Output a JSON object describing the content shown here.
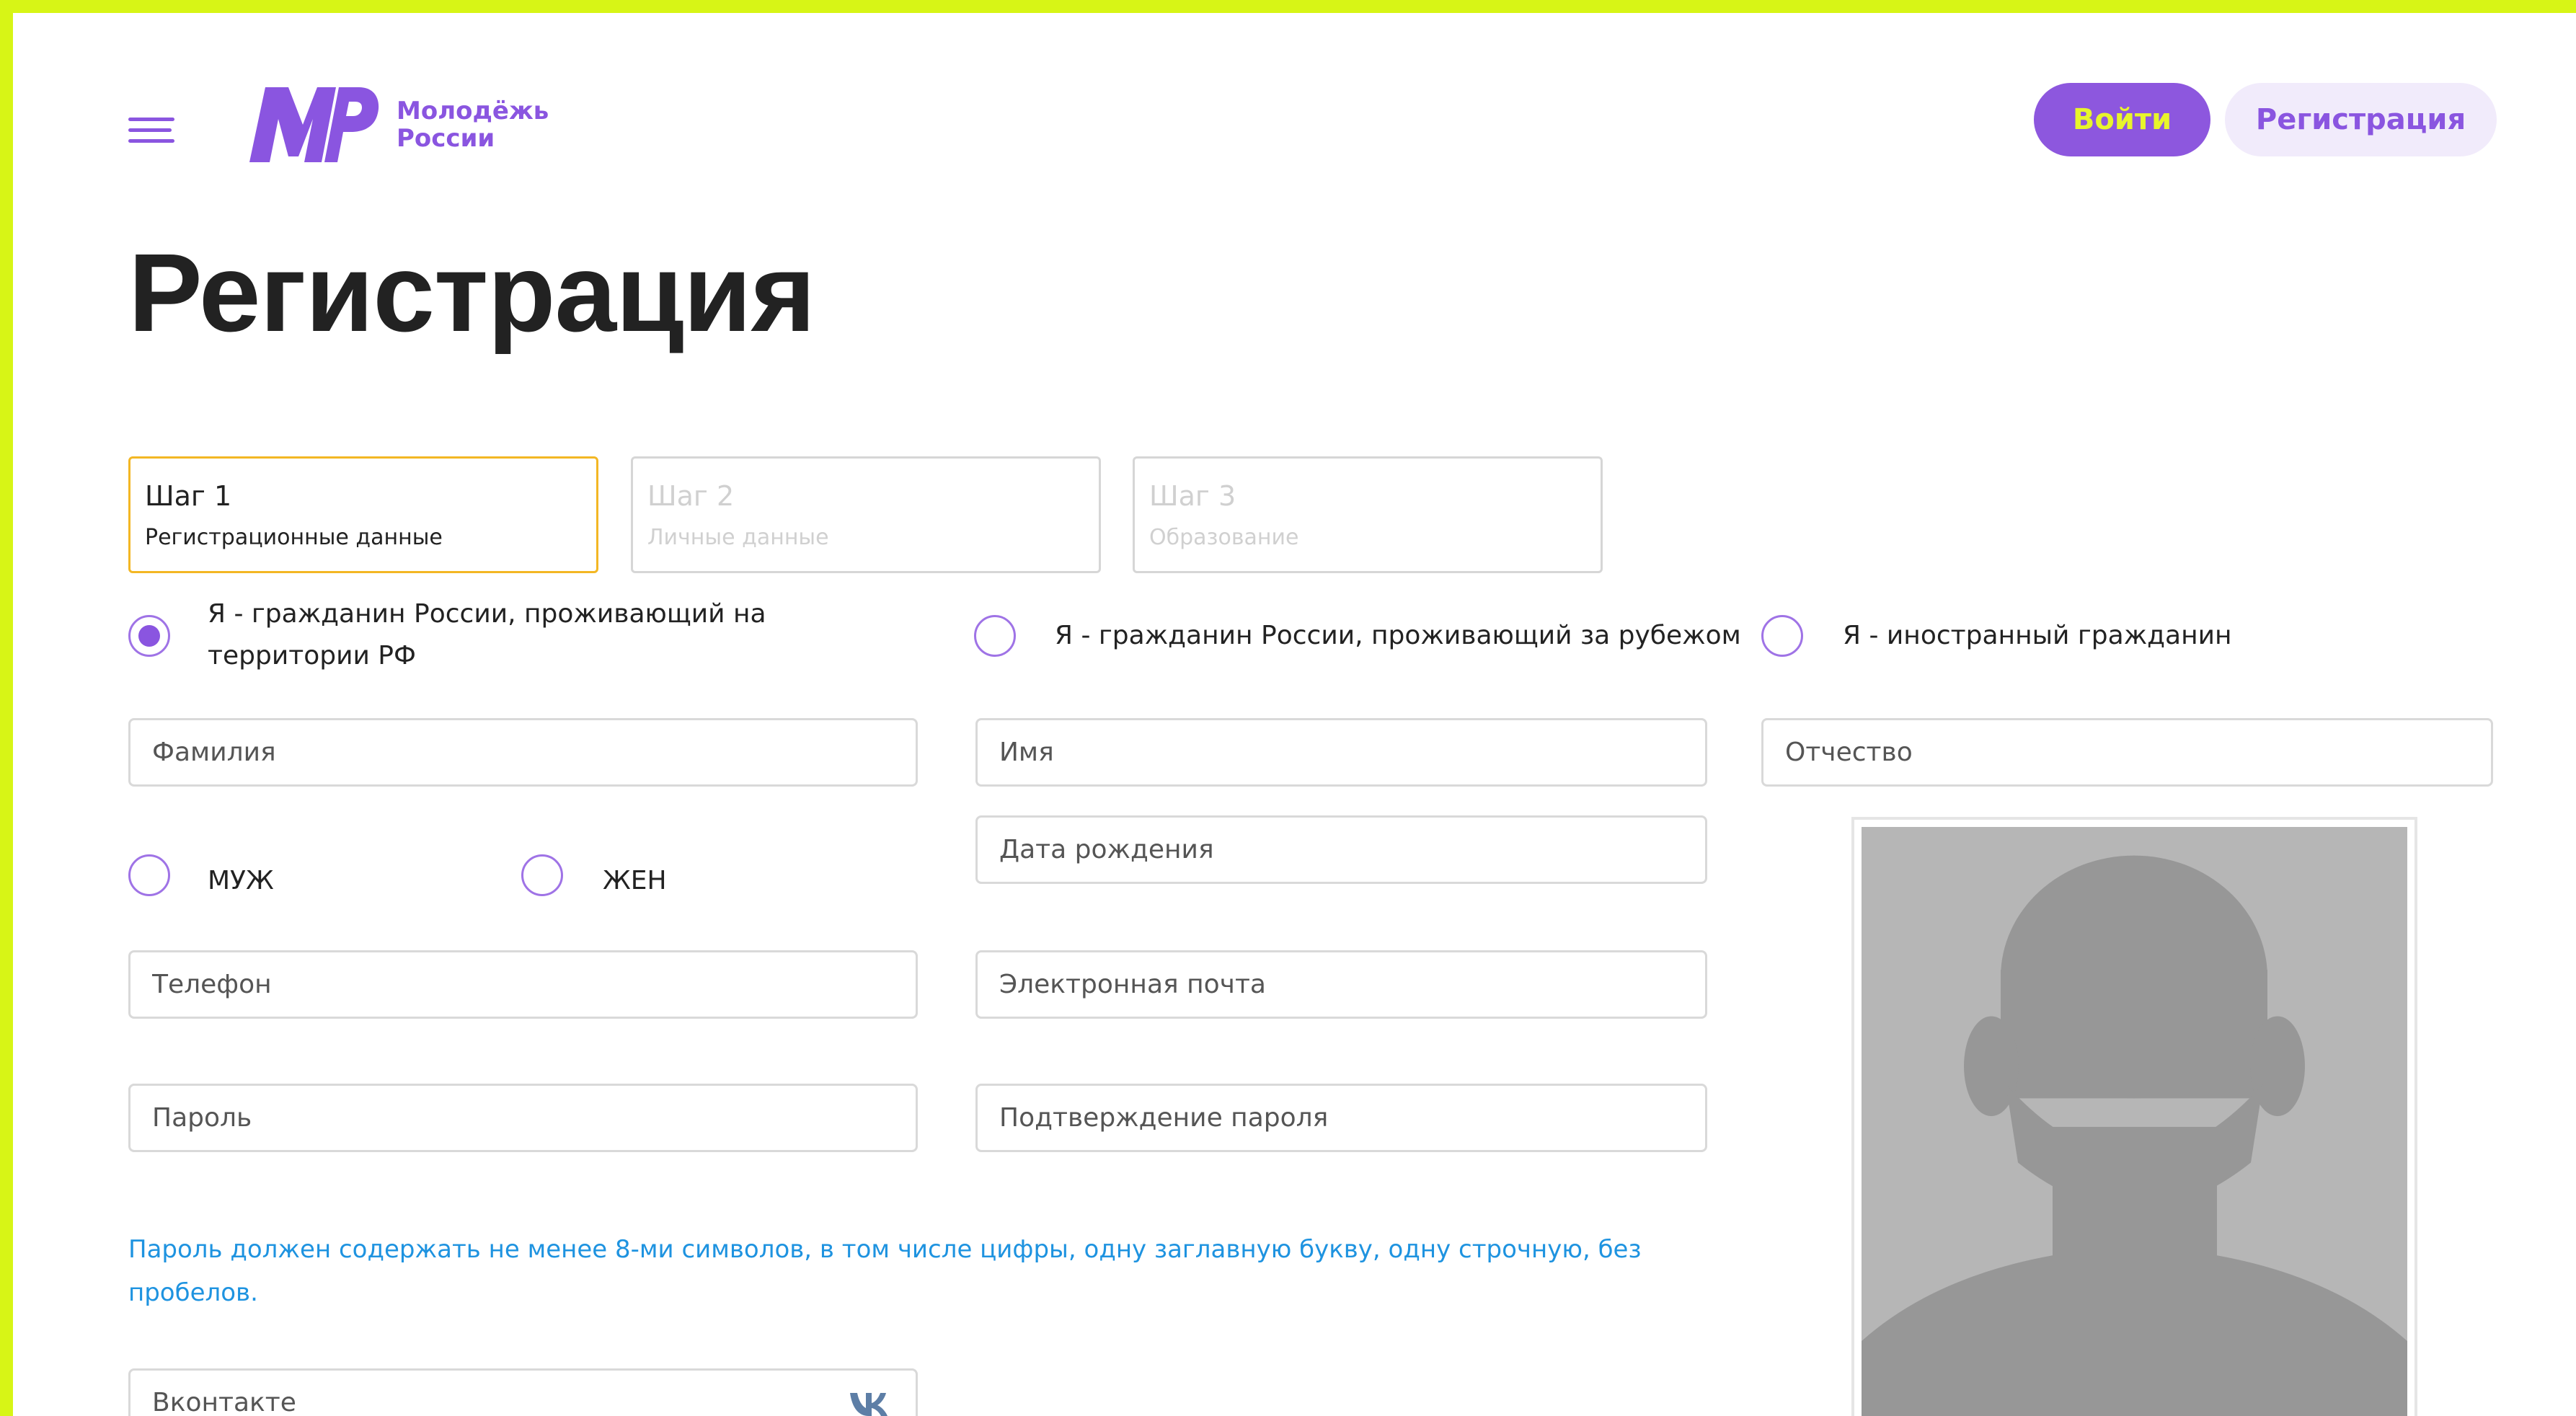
{
  "header": {
    "logo_line1": "Молодёжь",
    "logo_line2": "России",
    "login_label": "Войти",
    "register_label": "Регистрация"
  },
  "page_title": "Регистрация",
  "steps": [
    {
      "number": "Шаг 1",
      "label": "Регистрационные данные",
      "active": true
    },
    {
      "number": "Шаг 2",
      "label": "Личные данные",
      "active": false
    },
    {
      "number": "Шаг 3",
      "label": "Образование",
      "active": false
    }
  ],
  "citizenship": {
    "options": [
      {
        "label": "Я - гражданин России, проживающий на территории РФ",
        "checked": true
      },
      {
        "label": "Я - гражданин России, проживающий за рубежом",
        "checked": false
      },
      {
        "label": "Я - иностранный гражданин",
        "checked": false
      }
    ]
  },
  "fields": {
    "last_name": "Фамилия",
    "first_name": "Имя",
    "middle_name": "Отчество",
    "birth_date": "Дата рождения",
    "phone": "Телефон",
    "email": "Электронная почта",
    "password": "Пароль",
    "password_confirm": "Подтверждение пароля",
    "vk": "Вконтакте"
  },
  "gender": {
    "male": "МУЖ",
    "female": "ЖЕН"
  },
  "password_hint": "Пароль должен содержать не менее 8-ми символов, в том числе цифры, одну заглавную букву, одну строчную, без пробелов.",
  "colors": {
    "accent": "#8a55e0",
    "highlight": "#d7f516",
    "active_step_border": "#f3b724",
    "hint_text": "#1e93e0"
  },
  "icons": {
    "menu": "hamburger-menu-icon",
    "vk": "vk-icon",
    "photo_placeholder": "avatar-silhouette"
  }
}
